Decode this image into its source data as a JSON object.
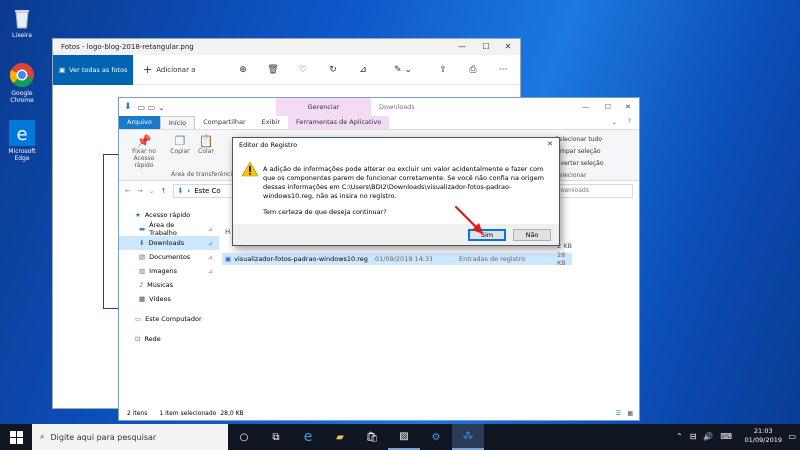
{
  "desktop": {
    "icons": [
      {
        "label": "Lixeira",
        "icon": "recycle-bin-icon"
      },
      {
        "label": "Google Chrome",
        "icon": "chrome-icon"
      },
      {
        "label": "Microsoft Edge",
        "icon": "edge-icon"
      }
    ]
  },
  "photos": {
    "title": "Fotos - logo-blog-2018-retangular.png",
    "view_all": "Ver todas as fotos",
    "add_to": "Adicionar a",
    "controls": [
      "—",
      "☐",
      "✕"
    ]
  },
  "explorer": {
    "context_group": "Gerenciar",
    "title": "Downloads",
    "tabs": [
      "Arquivo",
      "Início",
      "Compartilhar",
      "Exibir",
      "Ferramentas de Aplicativo"
    ],
    "ribbon": {
      "pin": "Fixar no Acesso rápido",
      "copy": "Copiar",
      "paste": "Colar",
      "clipboard_group": "Área de transferência",
      "select_all": "Selecionar tudo",
      "clear_selection": "Limpar seleção",
      "invert_selection": "Inverter seleção",
      "select_group": "Selecionar"
    },
    "address": "Este Co",
    "search_placeholder": "Downloads",
    "nav": {
      "quick_access": "Acesso rápido",
      "desktop": "Área de Trabalho",
      "downloads": "Downloads",
      "documents": "Documentos",
      "images": "Imagens",
      "music": "Músicas",
      "videos": "Vídeos",
      "this_pc": "Este Computador",
      "network": "Rede"
    },
    "group_header": "H",
    "files": [
      {
        "size": "2 KB"
      },
      {
        "name": "visualizador-fotos-padrao-windows10.reg",
        "date": "01/09/2019 14:31",
        "type": "Entradas de registro",
        "size": "28 KB"
      }
    ],
    "status": {
      "count": "2 itens",
      "selected": "1 item selecionado",
      "size": "28,0 KB"
    }
  },
  "dialog": {
    "title": "Editor do Registro",
    "message": "A adição de informações pode alterar ou excluir um valor acidentalmente e fazer com que os componentes parem de funcionar corretamente. Se você não confia na origem dessas informações em C:\\Users\\BDI2\\Downloads\\visualizador-fotos-padrao-windows10.reg, não as insira no registro.",
    "question": "Tem certeza de que deseja continuar?",
    "yes": "Sim",
    "no": "Não"
  },
  "taskbar": {
    "search_placeholder": "Digite aqui para pesquisar",
    "time": "21:03",
    "date": "01/09/2019"
  }
}
